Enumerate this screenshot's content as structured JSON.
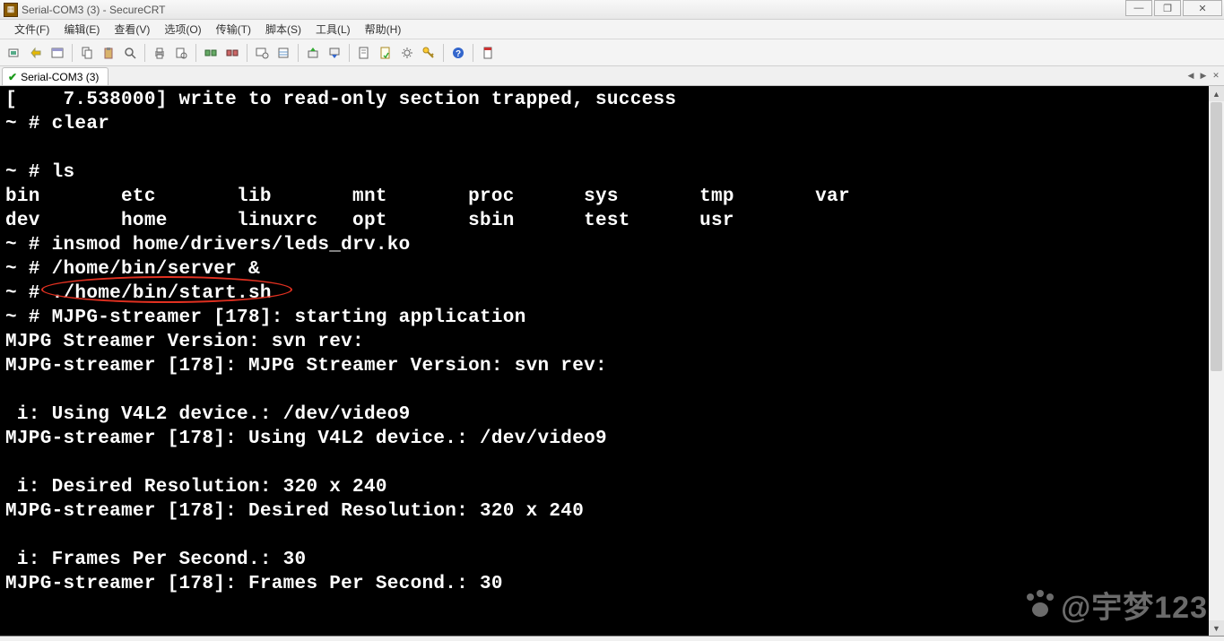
{
  "window": {
    "title": "Serial-COM3 (3) - SecureCRT"
  },
  "menu": {
    "file": "文件(F)",
    "edit": "编辑(E)",
    "view": "查看(V)",
    "options": "选项(O)",
    "transfer": "传输(T)",
    "script": "脚本(S)",
    "tools": "工具(L)",
    "help": "帮助(H)"
  },
  "tab": {
    "label": "Serial-COM3 (3)"
  },
  "terminal": {
    "lines": [
      "[    7.538000] write to read-only section trapped, success",
      "~ # clear",
      "",
      "~ # ls",
      "bin       etc       lib       mnt       proc      sys       tmp       var",
      "dev       home      linuxrc   opt       sbin      test      usr",
      "~ # insmod home/drivers/leds_drv.ko",
      "~ # /home/bin/server &",
      "~ # ./home/bin/start.sh",
      "~ # MJPG-streamer [178]: starting application",
      "MJPG Streamer Version: svn rev: ",
      "MJPG-streamer [178]: MJPG Streamer Version: svn rev: ",
      "",
      " i: Using V4L2 device.: /dev/video9",
      "MJPG-streamer [178]: Using V4L2 device.: /dev/video9",
      "",
      " i: Desired Resolution: 320 x 240",
      "MJPG-streamer [178]: Desired Resolution: 320 x 240",
      "",
      " i: Frames Per Second.: 30",
      "MJPG-streamer [178]: Frames Per Second.: 30",
      ""
    ],
    "highlightedLineIndex": 8
  },
  "watermark": "@宇梦123",
  "toolbar_icons": [
    "connect",
    "quick-connect",
    "explorer",
    "sep",
    "copy",
    "paste",
    "find",
    "sep",
    "print",
    "print-preview",
    "sep",
    "reconnect",
    "disconnect",
    "sep",
    "session-options",
    "global-options",
    "sep",
    "transfer-send",
    "transfer-recv",
    "sep",
    "open-log",
    "toggle-log",
    "settings",
    "key",
    "sep",
    "help",
    "sep",
    "about"
  ]
}
